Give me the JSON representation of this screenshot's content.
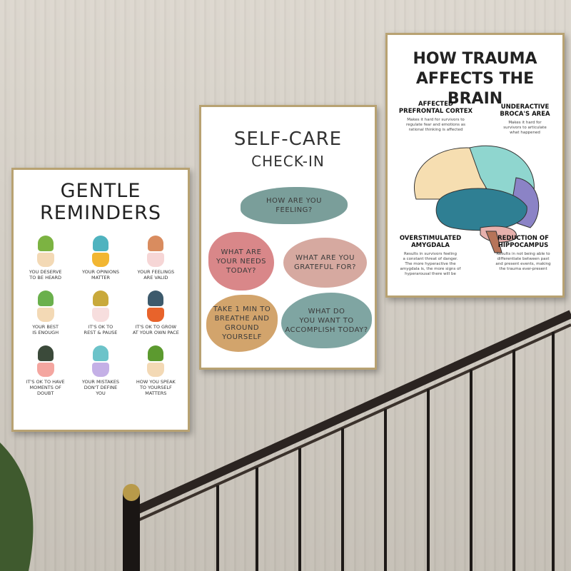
{
  "poster_left": {
    "title": "GENTLE\nREMINDERS",
    "items": [
      {
        "text": "YOU DESERVE\nTO BE HEARD",
        "leaf": "#7cb342",
        "pot": "#f3d9b5"
      },
      {
        "text": "YOUR OPINIONS\nMATTER",
        "leaf": "#4fb3bf",
        "pot": "#f2b632"
      },
      {
        "text": "YOUR FEELINGS\nARE VALID",
        "leaf": "#d98c5f",
        "pot": "#f6d6d6"
      },
      {
        "text": "YOUR BEST\nIS ENOUGH",
        "leaf": "#6ab04c",
        "pot": "#f3d9b5"
      },
      {
        "text": "IT'S OK TO\nREST & PAUSE",
        "leaf": "#c9a93b",
        "pot": "#f7dede"
      },
      {
        "text": "IT'S OK TO GROW\nAT YOUR OWN PACE",
        "leaf": "#3d5a6c",
        "pot": "#e8632b"
      },
      {
        "text": "IT'S OK TO HAVE\nMOMENTS OF\nDOUBT",
        "leaf": "#3b4a3a",
        "pot": "#f4a6a0"
      },
      {
        "text": "YOUR MISTAKES\nDON'T DEFINE\nYOU",
        "leaf": "#6cc3c9",
        "pot": "#c4b0e6"
      },
      {
        "text": "HOW YOU SPEAK\nTO YOURSELF\nMATTERS",
        "leaf": "#5c9a2f",
        "pot": "#f3d9b5"
      }
    ]
  },
  "poster_middle": {
    "title": "SELF-CARE",
    "subtitle": "CHECK-IN",
    "bubbles": [
      {
        "text": "HOW ARE YOU\nFEELING?",
        "color": "#7a9e9a"
      },
      {
        "text": "WHAT ARE\nYOUR NEEDS\nTODAY?",
        "color": "#d98789"
      },
      {
        "text": "WHAT ARE YOU\nGRATEFUL FOR?",
        "color": "#d6a9a0"
      },
      {
        "text": "TAKE 1 MIN TO\nBREATHE AND\nGROUND\nYOURSELF",
        "color": "#d2a46c"
      },
      {
        "text": "WHAT DO\nYOU WANT TO\nACCOMPLISH TODAY?",
        "color": "#7fa5a2"
      }
    ]
  },
  "poster_right": {
    "title": "HOW TRAUMA\nAFFECTS THE BRAIN",
    "regions": [
      {
        "label": "AFFECTED\nPREFRONTAL CORTEX",
        "desc": "Makes it hard for survivors to\nregulate fear and emotions as\nrational thinking is affected"
      },
      {
        "label": "UNDERACTIVE\nBROCA'S AREA",
        "desc": "Makes it hard for\nsurvivors to articulate\nwhat happened"
      },
      {
        "label": "OVERSTIMULATED\nAMYGDALA",
        "desc": "Results in survivors feeling\na constant threat of danger.\nThe more hyperactive the\namygdala is, the more signs of\nhyperarousal there will be"
      },
      {
        "label": "REDUCTION OF\nHIPPOCAMPUS",
        "desc": "Results in not being able to\ndifferentiate between past\nand present events, making\nthe trauma ever-present"
      }
    ]
  }
}
